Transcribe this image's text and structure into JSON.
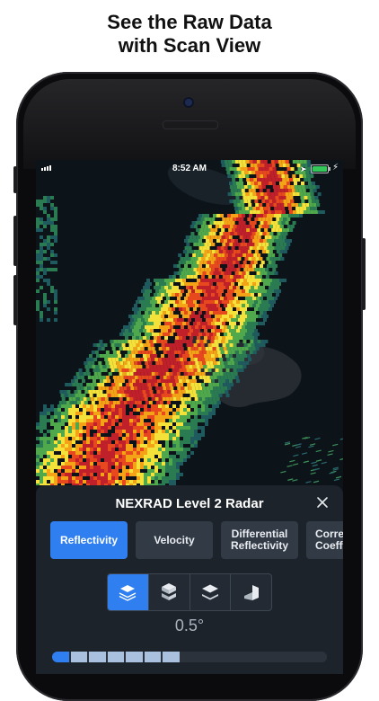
{
  "headline": {
    "line1": "See the Raw Data",
    "line2": "with Scan View"
  },
  "statusbar": {
    "time": "8:52 AM"
  },
  "panel": {
    "title": "NEXRAD Level 2 Radar",
    "products": [
      {
        "label": "Reflectivity",
        "active": true
      },
      {
        "label": "Velocity",
        "active": false
      },
      {
        "label": "Differential Reflectivity",
        "active": false
      },
      {
        "label": "Corre Coeff",
        "active": false
      }
    ],
    "view_modes": [
      "ppi-scan-icon",
      "volume-stack-icon",
      "layer-stack-icon",
      "cross-section-icon"
    ],
    "elevation": "0.5°",
    "scan_progress": {
      "filled_segments": 7,
      "total_segments": 15
    }
  },
  "colors": {
    "accent": "#2f7ff0",
    "panel_bg": "#1d232b",
    "button_bg": "#323a45"
  }
}
